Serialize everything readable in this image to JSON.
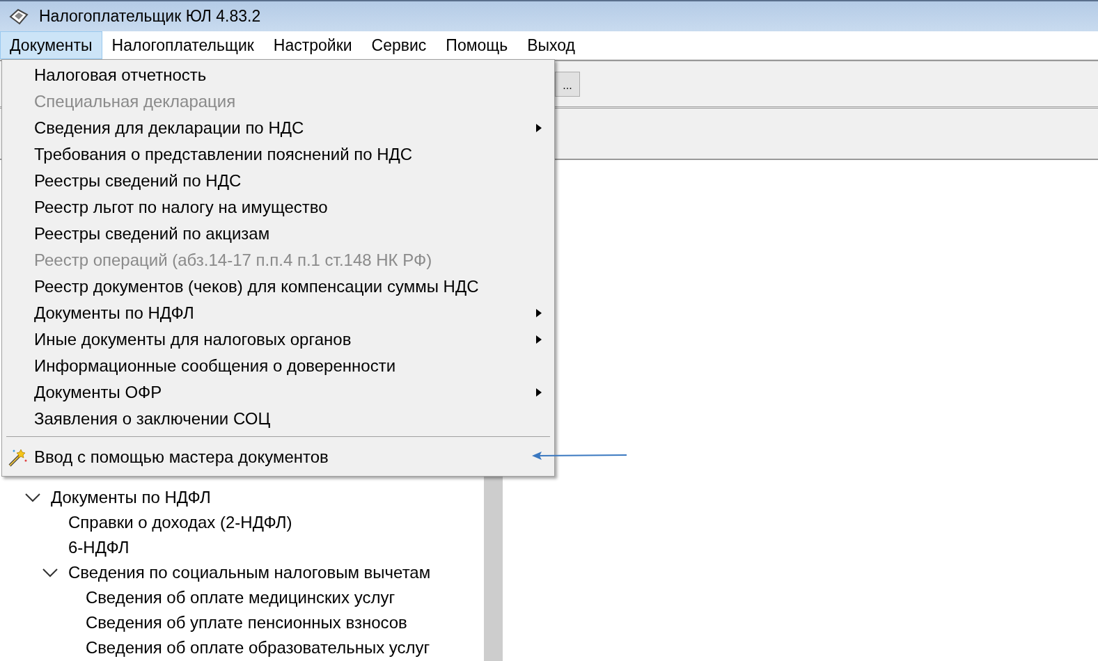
{
  "window": {
    "title": "Налогоплательщик ЮЛ 4.83.2"
  },
  "menu_bar": [
    {
      "label": "Документы",
      "selected": true
    },
    {
      "label": "Налогоплательщик",
      "selected": false
    },
    {
      "label": "Настройки",
      "selected": false
    },
    {
      "label": "Сервис",
      "selected": false
    },
    {
      "label": "Помощь",
      "selected": false
    },
    {
      "label": "Выход",
      "selected": false
    }
  ],
  "toolbar": {
    "browse_button": "..."
  },
  "documents_menu": {
    "items": [
      {
        "kind": "item",
        "label": "Налоговая отчетность",
        "disabled": false,
        "submenu": false
      },
      {
        "kind": "item",
        "label": "Специальная декларация",
        "disabled": true,
        "submenu": false
      },
      {
        "kind": "item",
        "label": "Сведения для декларации по НДС",
        "disabled": false,
        "submenu": true
      },
      {
        "kind": "item",
        "label": "Требования о представлении пояснений по НДС",
        "disabled": false,
        "submenu": false
      },
      {
        "kind": "item",
        "label": "Реестры сведений по НДС",
        "disabled": false,
        "submenu": false
      },
      {
        "kind": "item",
        "label": "Реестр льгот по налогу на имущество",
        "disabled": false,
        "submenu": false
      },
      {
        "kind": "item",
        "label": "Реестры сведений по акцизам",
        "disabled": false,
        "submenu": false
      },
      {
        "kind": "item",
        "label": "Реестр операций (абз.14-17 п.п.4 п.1 ст.148 НК РФ)",
        "disabled": true,
        "submenu": false
      },
      {
        "kind": "item",
        "label": "Реестр документов (чеков) для компенсации суммы НДС",
        "disabled": false,
        "submenu": false
      },
      {
        "kind": "item",
        "label": "Документы по НДФЛ",
        "disabled": false,
        "submenu": true
      },
      {
        "kind": "item",
        "label": "Иные документы для налоговых органов",
        "disabled": false,
        "submenu": true
      },
      {
        "kind": "item",
        "label": "Информационные сообщения о доверенности",
        "disabled": false,
        "submenu": false
      },
      {
        "kind": "item",
        "label": "Документы ОФР",
        "disabled": false,
        "submenu": true
      },
      {
        "kind": "item",
        "label": "Заявления о заключении СОЦ",
        "disabled": false,
        "submenu": false
      },
      {
        "kind": "separator"
      },
      {
        "kind": "wizard_item",
        "label": "Ввод с помощью мастера документов",
        "disabled": false,
        "submenu": false
      }
    ]
  },
  "tree": [
    {
      "label": "Документы по НДФЛ",
      "expanded": true,
      "children": [
        {
          "label": "Справки о доходах (2-НДФЛ)"
        },
        {
          "label": "6-НДФЛ"
        },
        {
          "label": "Сведения по социальным налоговым вычетам",
          "expanded": true,
          "children": [
            {
              "label": "Сведения об оплате медицинских услуг"
            },
            {
              "label": "Сведения об уплате пенсионных взносов"
            },
            {
              "label": "Сведения об оплате образовательных услуг"
            }
          ]
        }
      ]
    }
  ]
}
